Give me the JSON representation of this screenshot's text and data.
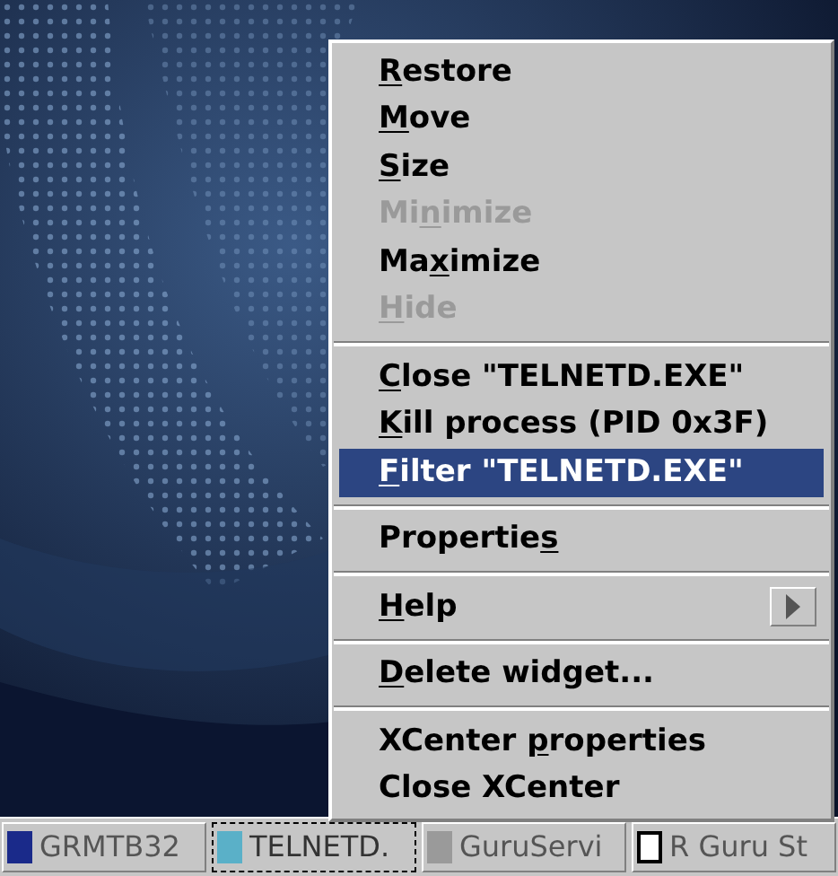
{
  "taskbar": {
    "items": [
      {
        "label": "GRMTB32",
        "selected": false
      },
      {
        "label": "TELNETD.",
        "selected": true
      },
      {
        "label": "GuruServi",
        "selected": false
      },
      {
        "label": "R Guru St",
        "selected": false
      }
    ]
  },
  "context_menu": {
    "items": [
      {
        "kind": "item",
        "key": "R",
        "post": "estore",
        "disabled": false,
        "selected": false
      },
      {
        "kind": "item",
        "key": "M",
        "post": "ove",
        "disabled": false,
        "selected": false
      },
      {
        "kind": "item",
        "key": "S",
        "post": "ize",
        "disabled": false,
        "selected": false
      },
      {
        "kind": "item",
        "pre": "Mi",
        "key": "n",
        "post": "imize",
        "disabled": true,
        "selected": false
      },
      {
        "kind": "item",
        "pre": "Ma",
        "key": "x",
        "post": "imize",
        "disabled": false,
        "selected": false
      },
      {
        "kind": "item",
        "key": "H",
        "post": "ide",
        "disabled": true,
        "selected": false
      },
      {
        "kind": "separator"
      },
      {
        "kind": "item",
        "key": "C",
        "post": "lose \"TELNETD.EXE\"",
        "disabled": false,
        "selected": false
      },
      {
        "kind": "item",
        "key": "K",
        "post": "ill process (PID 0x3F)",
        "disabled": false,
        "selected": false
      },
      {
        "kind": "item",
        "key": "F",
        "post": "ilter \"TELNETD.EXE\"",
        "disabled": false,
        "selected": true
      },
      {
        "kind": "separator"
      },
      {
        "kind": "item",
        "pre": "Propertie",
        "key": "s",
        "disabled": false,
        "selected": false
      },
      {
        "kind": "separator"
      },
      {
        "kind": "submenu",
        "key": "H",
        "post": "elp",
        "disabled": false,
        "selected": false
      },
      {
        "kind": "separator"
      },
      {
        "kind": "item",
        "key": "D",
        "post": "elete widget...",
        "disabled": false,
        "selected": false
      },
      {
        "kind": "separator"
      },
      {
        "kind": "item",
        "pre": "XCenter ",
        "key": "p",
        "post": "roperties",
        "disabled": false,
        "selected": false
      },
      {
        "kind": "item",
        "pre": "Close XCenter",
        "disabled": false,
        "selected": false
      }
    ]
  }
}
